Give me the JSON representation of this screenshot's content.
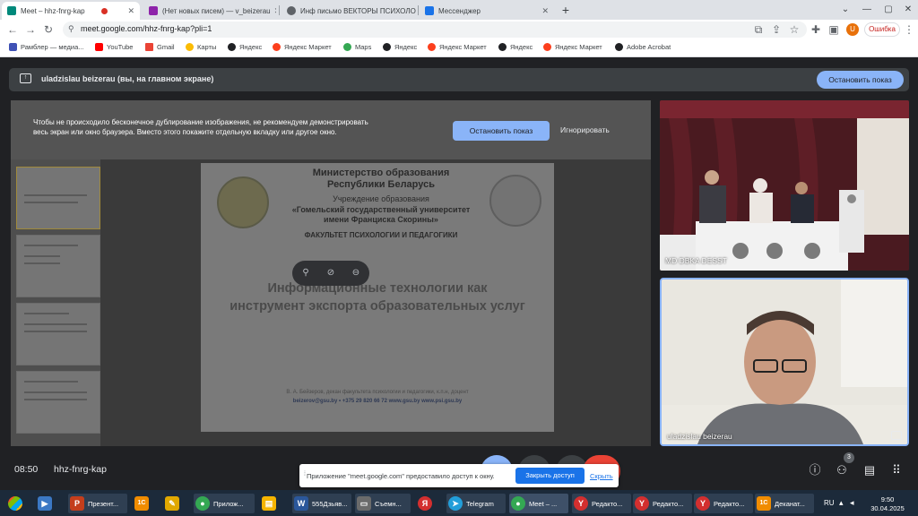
{
  "browser": {
    "tabs": [
      {
        "title": "Meet – hhz-fnrg-kap",
        "color": "#00897b"
      },
      {
        "title": "(Нет новых писем) — v_beizerau",
        "color": "#8e24aa"
      },
      {
        "title": "Инф письмо ВЕКТОРЫ ПСИХОЛОГИИ",
        "color": "#5f6368"
      },
      {
        "title": "Мессенджер",
        "color": "#1a73e8"
      }
    ],
    "url": "meet.google.com/hhz-fnrg-kap?pli=1",
    "profile_label": "Ошибка",
    "bookmarks": [
      {
        "label": "Рамблер — медиа...",
        "color": "#3f51b5"
      },
      {
        "label": "YouTube",
        "color": "#ff0000"
      },
      {
        "label": "Gmail",
        "color": "#ea4335"
      },
      {
        "label": "Карты",
        "color": "#fbbc04"
      },
      {
        "label": "Яндекс",
        "color": "#202124"
      },
      {
        "label": "Яндекс Маркет",
        "color": "#fc3f1d"
      },
      {
        "label": "Maps",
        "color": "#34a853"
      },
      {
        "label": "Яндекс",
        "color": "#202124"
      },
      {
        "label": "Яндекс Маркет",
        "color": "#fc3f1d"
      },
      {
        "label": "Яндекс",
        "color": "#202124"
      },
      {
        "label": "Яндекс Маркет",
        "color": "#fc3f1d"
      },
      {
        "label": "Adobe Acrobat",
        "color": "#202124"
      }
    ]
  },
  "meet": {
    "presenter_label": "uladzislau beizerau (вы, на главном экране)",
    "stop_presenting": "Остановить показ",
    "warning": "Чтобы не происходило бесконечное дублирование изображения, не рекомендуем демонстрировать весь экран или окно браузера. Вместо этого покажите отдельную вкладку или другое окно.",
    "stop_button": "Остановить показ",
    "ignore_button": "Игнорировать",
    "slide": {
      "ministry": "Министерство образования",
      "republic": "Республики Беларусь",
      "institution": "Учреждение образования",
      "university1": "«Гомельский государственный университет",
      "university2": "имени Франциска Скорины»",
      "faculty": "ФАКУЛЬТЕТ ПСИХОЛОГИИ И ПЕДАГОГИКИ",
      "title1": "Информационные технологии как",
      "title2": "инструмент экспорта образовательных услуг",
      "author": "В. А. Бейзеров, декан факультета психологии и педагогики, к.п.н, доцент",
      "contacts": "beizerov@gsu.by  • +375 29 820 66 72   www.gsu.by   www.psi.gsu.by"
    },
    "participants": [
      {
        "name": "MD DBKA DESST"
      },
      {
        "name": "uladzislau beizerau"
      }
    ],
    "time": "08:50",
    "meeting_code": "hhz-fnrg-kap",
    "participant_count": "3",
    "notification": {
      "text": "Приложение \"meet.google.com\" предоставило доступ к окну.",
      "share_button": "Закрыть доступ",
      "hide_link": "Скрыть"
    }
  },
  "taskbar": {
    "items": [
      {
        "label": "",
        "color": "#3b78c4",
        "glyph": "▶"
      },
      {
        "label": "Презент...",
        "color": "#c43e1c",
        "glyph": "P"
      },
      {
        "label": "",
        "color": "#f08c00",
        "glyph": "1С"
      },
      {
        "label": "",
        "color": "#e0a800",
        "glyph": "✎"
      },
      {
        "label": "Прилож...",
        "color": "#34a853",
        "glyph": "●"
      },
      {
        "label": "",
        "color": "#f4b400",
        "glyph": "▤"
      },
      {
        "label": "555Дзьяв...",
        "color": "#2b579a",
        "glyph": "W"
      },
      {
        "label": "Съемн...",
        "color": "#6b6b6b",
        "glyph": "▭"
      },
      {
        "label": "",
        "color": "#d32f2f",
        "glyph": "Я"
      },
      {
        "label": "Telegram",
        "color": "#229ed9",
        "glyph": "➤"
      },
      {
        "label": "Meet – ...",
        "color": "#34a853",
        "glyph": "●"
      },
      {
        "label": "Редакто...",
        "color": "#d32f2f",
        "glyph": "Y"
      },
      {
        "label": "Редакто...",
        "color": "#d32f2f",
        "glyph": "Y"
      },
      {
        "label": "Редакто...",
        "color": "#d32f2f",
        "glyph": "Y"
      },
      {
        "label": "Деканат...",
        "color": "#f08c00",
        "glyph": "1С"
      }
    ],
    "lang": "RU",
    "clock_time": "9:50",
    "clock_date": "30.04.2025"
  }
}
